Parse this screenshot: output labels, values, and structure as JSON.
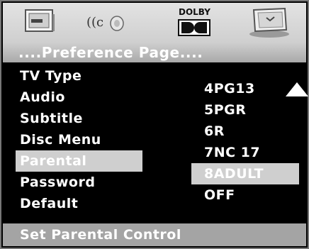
{
  "toolbar": {
    "icons": [
      "general-setup-icon",
      "audio-setup-icon",
      "dolby-icon",
      "preference-icon"
    ],
    "dolby_label": "DOLBY"
  },
  "page": {
    "title": "....Preference Page...."
  },
  "menu": {
    "items": [
      {
        "label": "TV Type"
      },
      {
        "label": "Audio"
      },
      {
        "label": "Subtitle"
      },
      {
        "label": "Disc Menu"
      },
      {
        "label": "Parental"
      },
      {
        "label": "Password"
      },
      {
        "label": "Default"
      }
    ],
    "selected": "Parental"
  },
  "options": {
    "items": [
      {
        "label": "4PG13"
      },
      {
        "label": "5PGR"
      },
      {
        "label": "6R"
      },
      {
        "label": "7NC 17"
      },
      {
        "label": "8ADULT"
      },
      {
        "label": "OFF"
      }
    ],
    "selected": "8ADULT"
  },
  "status": {
    "text": "Set Parental Control"
  },
  "colors": {
    "background": "#000000",
    "highlight": "#cfcfcf",
    "text": "#ffffff"
  }
}
